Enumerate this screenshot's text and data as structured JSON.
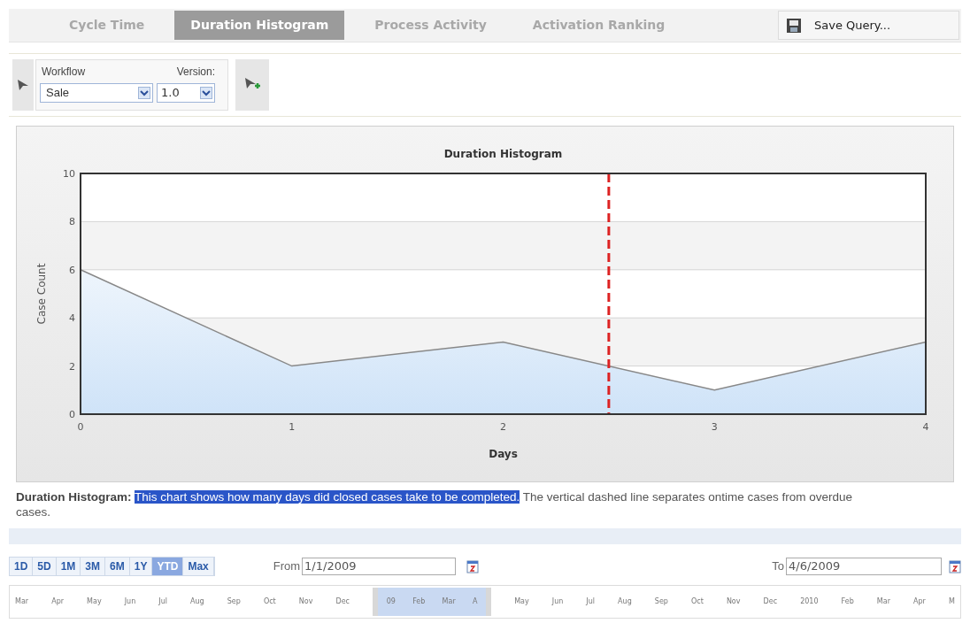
{
  "tabs": [
    {
      "label": "Cycle Time",
      "selected": false
    },
    {
      "label": "Duration Histogram",
      "selected": true
    },
    {
      "label": "Process Activity",
      "selected": false
    },
    {
      "label": "Activation Ranking",
      "selected": false
    }
  ],
  "save_button": {
    "label": "Save Query..."
  },
  "filter": {
    "workflow_label": "Workflow",
    "workflow_value": "Sale",
    "version_label": "Version:",
    "version_value": "1.0"
  },
  "chart": {
    "chart_data": {
      "type": "area",
      "title": "Duration Histogram",
      "xlabel": "Days",
      "ylabel": "Case Count",
      "x": [
        0,
        1,
        2,
        3,
        4
      ],
      "series": [
        {
          "color": "#888888",
          "values": [
            6,
            2,
            3,
            1,
            3
          ]
        }
      ],
      "xlim": [
        0,
        4
      ],
      "ylim": [
        0,
        10
      ],
      "xticks": [
        0,
        1,
        2,
        3,
        4
      ],
      "yticks": [
        0,
        2,
        4,
        6,
        8,
        10
      ],
      "grid": true,
      "ref_lines": [
        {
          "axis": "x",
          "value": 2.5
        }
      ]
    }
  },
  "description": {
    "label": "Duration Histogram:",
    "highlighted": "This chart shows how many days did closed cases take to be completed.",
    "rest": "The vertical dashed line separates ontime cases from overdue cases."
  },
  "ranges": [
    {
      "label": "1D",
      "selected": false
    },
    {
      "label": "5D",
      "selected": false
    },
    {
      "label": "1M",
      "selected": false
    },
    {
      "label": "3M",
      "selected": false
    },
    {
      "label": "6M",
      "selected": false
    },
    {
      "label": "1Y",
      "selected": false
    },
    {
      "label": "YTD",
      "selected": true
    },
    {
      "label": "Max",
      "selected": false
    }
  ],
  "from": {
    "label": "From",
    "value": "1/1/2009"
  },
  "to": {
    "label": "To",
    "value": "4/6/2009"
  },
  "timeline": {
    "before": [
      "Mar",
      "Apr",
      "May",
      "Jun",
      "Jul",
      "Aug",
      "Sep",
      "Oct",
      "Nov",
      "Dec"
    ],
    "selection": [
      "09",
      "Feb",
      "Mar",
      "A"
    ],
    "after": [
      "May",
      "Jun",
      "Jul",
      "Aug",
      "Sep",
      "Oct",
      "Nov",
      "Dec",
      "2010",
      "Feb",
      "Mar",
      "Apr",
      "M"
    ]
  }
}
